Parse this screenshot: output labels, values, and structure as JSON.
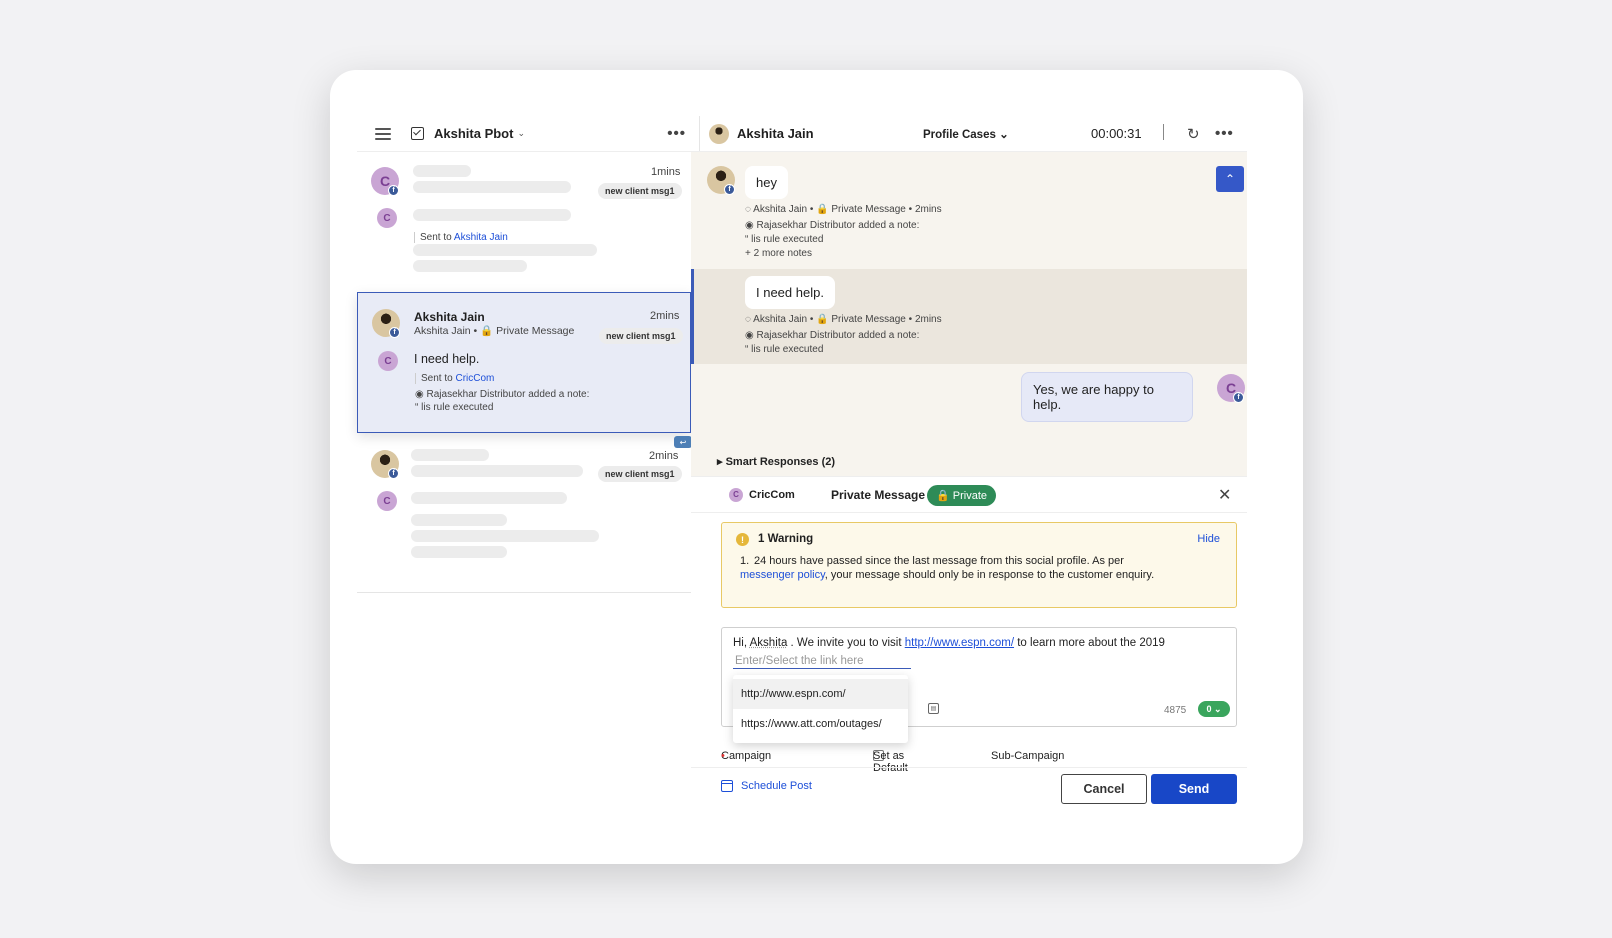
{
  "left": {
    "workspace": "Akshita Pbot",
    "items": [
      {
        "time": "1mins",
        "tag": "new client msg1",
        "avatar_letter": "C",
        "sub_letter": "C",
        "sent_to_prefix": "Sent to ",
        "sent_to": "Akshita Jain"
      },
      {
        "name": "Akshita Jain",
        "time": "2mins",
        "tag": "new client msg1",
        "meta_name": "Akshita Jain",
        "meta_type": "Private Message",
        "sub_letter": "C",
        "message": "I need help.",
        "sent_to_prefix": "Sent to ",
        "sent_to": "CricCom",
        "note": "Rajasekhar Distributor added a note:",
        "quote": "lis rule executed"
      },
      {
        "time": "2mins",
        "tag": "new client msg1",
        "sub_letter": "C"
      }
    ]
  },
  "header": {
    "name": "Akshita Jain",
    "profile_cases": "Profile Cases",
    "timer": "00:00:31"
  },
  "conversation": {
    "messages": [
      {
        "text": "hey",
        "author": "Akshita Jain",
        "type": "Private Message",
        "time": "2mins",
        "note": "Rajasekhar Distributor added a note:",
        "quote": "lis rule executed",
        "more": "+ 2 more notes"
      },
      {
        "text": "I need help.",
        "author": "Akshita Jain",
        "type": "Private Message",
        "time": "2mins",
        "note": "Rajasekhar Distributor added a note:",
        "quote": "lis rule executed"
      },
      {
        "text": "Yes, we are happy to help.",
        "avatar_letter": "C"
      }
    ],
    "smart_responses": "Smart Responses (2)"
  },
  "composer": {
    "account": "CricCom",
    "account_letter": "C",
    "message_type": "Private Message",
    "privacy": "Private",
    "warning": {
      "title": "1 Warning",
      "hide": "Hide",
      "num": "1.",
      "text_before": "24 hours have passed since the last message from this social profile. As per ",
      "link": "messenger policy",
      "text_after": ", your message should only be in response to the customer enquiry."
    },
    "editor": {
      "prefix": "Hi, ",
      "name": "Akshita",
      "middle": " . We invite you to visit ",
      "url": "http://www.espn.com/",
      "suffix": " to learn more about the 2019",
      "placeholder": "Enter/Select the link here",
      "char_count": "4875",
      "count_pill": "0"
    },
    "link_options": [
      "http://www.espn.com/",
      "https://www.att.com/outages/"
    ],
    "campaign_label": "Campaign",
    "required_mark": "•",
    "set_default": "Set as Default",
    "sub_campaign": "Sub-Campaign",
    "schedule": "Schedule Post",
    "cancel": "Cancel",
    "send": "Send"
  },
  "colors": {
    "accent": "#1847c7",
    "private_green": "#2e8b57",
    "warning_bg": "#fdf9ea"
  }
}
